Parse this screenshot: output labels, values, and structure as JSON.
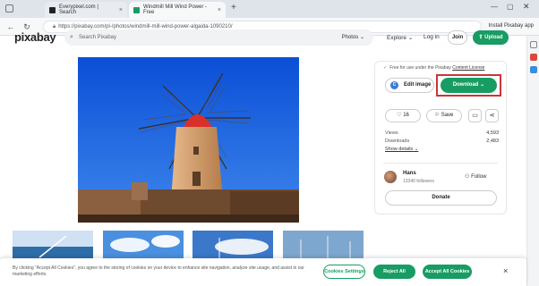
{
  "browser": {
    "tabs": [
      {
        "title": "Everypixel.com | Search"
      },
      {
        "title": "Windmill Mill Wind Power - Free"
      }
    ],
    "new_tab": "+",
    "url": "https://pixabay.com/pl-/photos/windmill-mill-wind-power-algaida-1090210/",
    "install_text": "Install Pixabay app",
    "colors": {
      "active_tab": "#f7f8fa",
      "tab_bar": "#dfe4ea"
    }
  },
  "header": {
    "logo": "pixabay",
    "search_placeholder": "Search Pixabay",
    "media_type": "Photos",
    "nav": {
      "explore": "Explore",
      "login": "Log in",
      "join": "Join",
      "upload": "Upload"
    }
  },
  "panel": {
    "free_text": "Free for use under the Pixabay",
    "license_link": "Content License",
    "edit_label": "Edit image",
    "download_label": "Download",
    "like_count": "16",
    "save_label": "Save",
    "views_label": "Views",
    "views_value": "4,593",
    "downloads_label": "Downloads",
    "downloads_value": "2,483",
    "show_details": "Show details",
    "user_name": "Hans",
    "user_followers": "13340 followers",
    "follow_label": "Follow",
    "donate_label": "Donate",
    "colors": {
      "accent": "#189c63",
      "highlight_frame": "#c9353b"
    }
  },
  "cookie": {
    "text": "By clicking \"Accept All Cookies\", you agree to the storing of cookies on your device to enhance site navigation, analyze site usage, and assist in our marketing efforts.",
    "settings_label": "Cookies Settings",
    "reject_label": "Reject All",
    "accept_label": "Accept All Cookies",
    "close": "×"
  }
}
